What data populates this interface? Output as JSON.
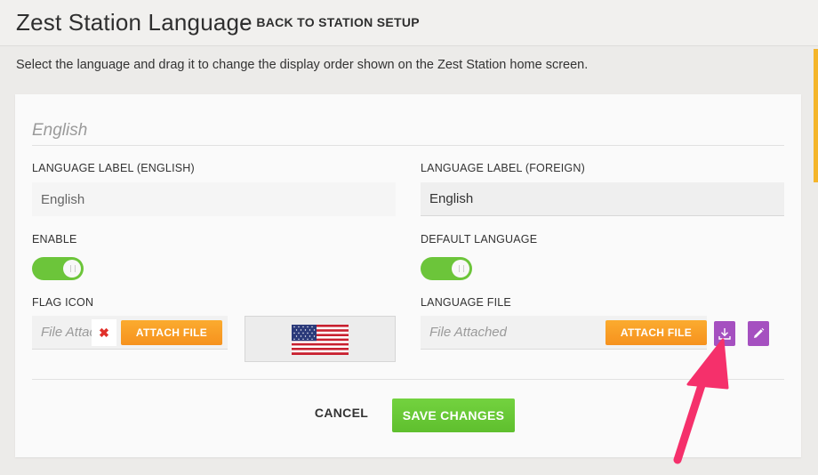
{
  "header": {
    "title": "Zest Station Language",
    "back_label": "BACK TO STATION SETUP"
  },
  "instructions": "Select the language and drag it to change the display order shown on the Zest Station home screen.",
  "language_card": {
    "section_title": "English",
    "label_english": {
      "label": "LANGUAGE LABEL (ENGLISH)",
      "value": "English"
    },
    "label_foreign": {
      "label": "LANGUAGE LABEL (FOREIGN)",
      "value": "English"
    },
    "enable": {
      "label": "ENABLE",
      "on": true
    },
    "default_language": {
      "label": "DEFAULT LANGUAGE",
      "on": true
    },
    "flag_icon": {
      "label": "FLAG ICON",
      "placeholder": "File Attached",
      "clear_glyph": "✖",
      "attach_label": "ATTACH FILE",
      "preview_icon": "us-flag-icon"
    },
    "language_file": {
      "label": "LANGUAGE FILE",
      "placeholder": "File Attached",
      "attach_label": "ATTACH FILE",
      "download_icon": "download-icon",
      "edit_icon": "pencil-icon"
    },
    "actions": {
      "cancel_label": "CANCEL",
      "save_label": "SAVE CHANGES"
    }
  },
  "colors": {
    "accent_orange": "#f6921e",
    "toggle_green": "#6cc53a",
    "save_green": "#66c735",
    "purple": "#a550c0",
    "annotation_pink": "#f5306b",
    "scroll_accent": "#f4b52a"
  }
}
